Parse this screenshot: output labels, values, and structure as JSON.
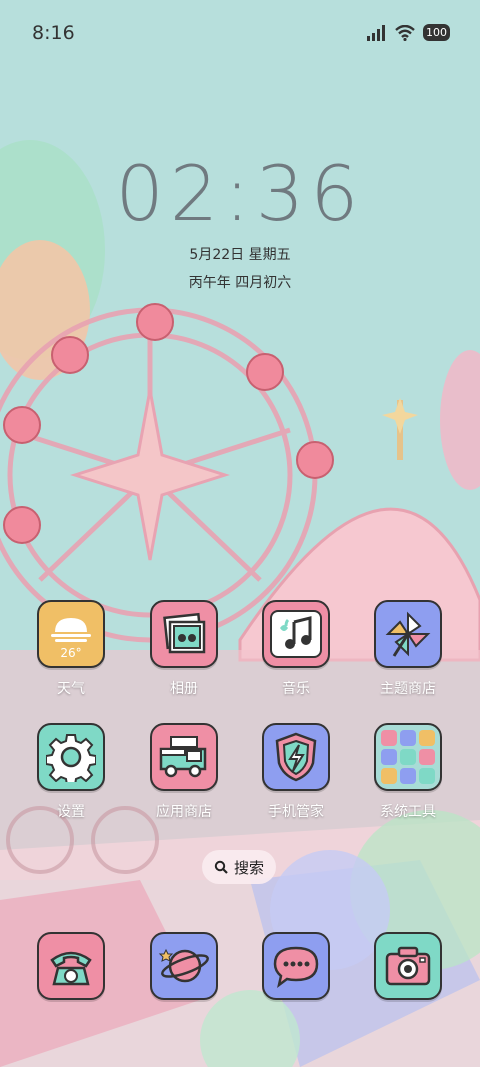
{
  "status_bar": {
    "time": "8:16",
    "battery": "100",
    "signal_icon": "cellular-signal-icon",
    "wifi_icon": "wifi-icon"
  },
  "clock": {
    "time": "02:36",
    "date": "5月22日 星期五",
    "lunar": "丙午年 四月初六"
  },
  "apps": [
    {
      "label": "天气",
      "badge": "26°",
      "icon": "weather-icon",
      "bg": "#f0bf66"
    },
    {
      "label": "相册",
      "icon": "gallery-icon",
      "bg": "#ef8fa5"
    },
    {
      "label": "音乐",
      "icon": "music-icon",
      "bg": "#ef8fa5"
    },
    {
      "label": "主题商店",
      "icon": "pinwheel-icon",
      "bg": "#8e9ef0"
    },
    {
      "label": "设置",
      "icon": "gear-icon",
      "bg": "#7fd9c6"
    },
    {
      "label": "应用商店",
      "icon": "shop-truck-icon",
      "bg": "#ef8fa5"
    },
    {
      "label": "手机管家",
      "icon": "shield-icon",
      "bg": "#8e9ef0"
    },
    {
      "label": "系统工具",
      "icon": "folder-icon",
      "bg": "#a8dcd6"
    }
  ],
  "search": {
    "label": "搜索",
    "icon": "search-icon"
  },
  "dock": [
    {
      "icon": "phone-icon",
      "bg": "#ef8fa5"
    },
    {
      "icon": "browser-planet-icon",
      "bg": "#8e9ef0"
    },
    {
      "icon": "messages-icon",
      "bg": "#8e9ef0"
    },
    {
      "icon": "camera-icon",
      "bg": "#7fd9c6"
    }
  ]
}
